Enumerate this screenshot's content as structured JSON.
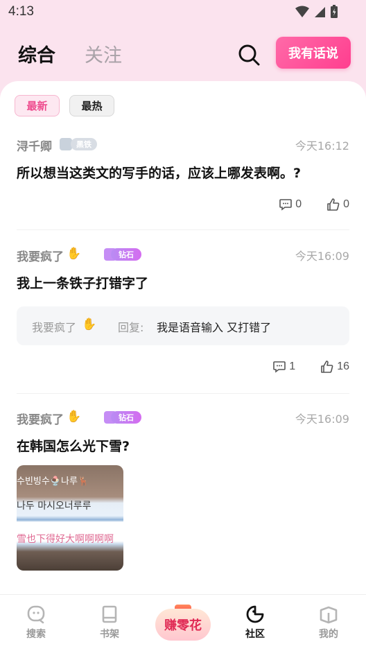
{
  "status_bar": {
    "time": "4:13"
  },
  "header": {
    "tab_main": "综合",
    "tab_follow": "关注",
    "say_button": "我有话说"
  },
  "filters": {
    "newest": "最新",
    "hottest": "最热"
  },
  "posts": [
    {
      "author": "浔千卿",
      "badge": "黑铁",
      "time": "今天16:12",
      "title": "所以想当这类文的写手的话，应该上哪发表啊。?",
      "comments": "0",
      "likes": "0"
    },
    {
      "author": "我要疯了",
      "badge": "钻石",
      "time": "今天16:09",
      "title": "我上一条铁子打错字了",
      "reply": {
        "author": "我要疯了",
        "label": "回复:",
        "text": "我是语音输入 又打错了"
      },
      "comments": "1",
      "likes": "16"
    },
    {
      "author": "我要疯了",
      "badge": "钻石",
      "time": "今天16:09",
      "title": "在韩国怎么光下雪?",
      "image_text": {
        "line1": "수빈빙수🍨나루🦌",
        "line2": "나두 마시오너루루",
        "line3": "雪也下得好大啊啊啊啊"
      }
    }
  ],
  "bottom_nav": {
    "search": "搜索",
    "bookshelf": "书架",
    "earn": "赚零花",
    "community": "社区",
    "mine": "我的"
  },
  "colors": {
    "accent": "#ff3e8f",
    "background": "#fbe3ee"
  }
}
